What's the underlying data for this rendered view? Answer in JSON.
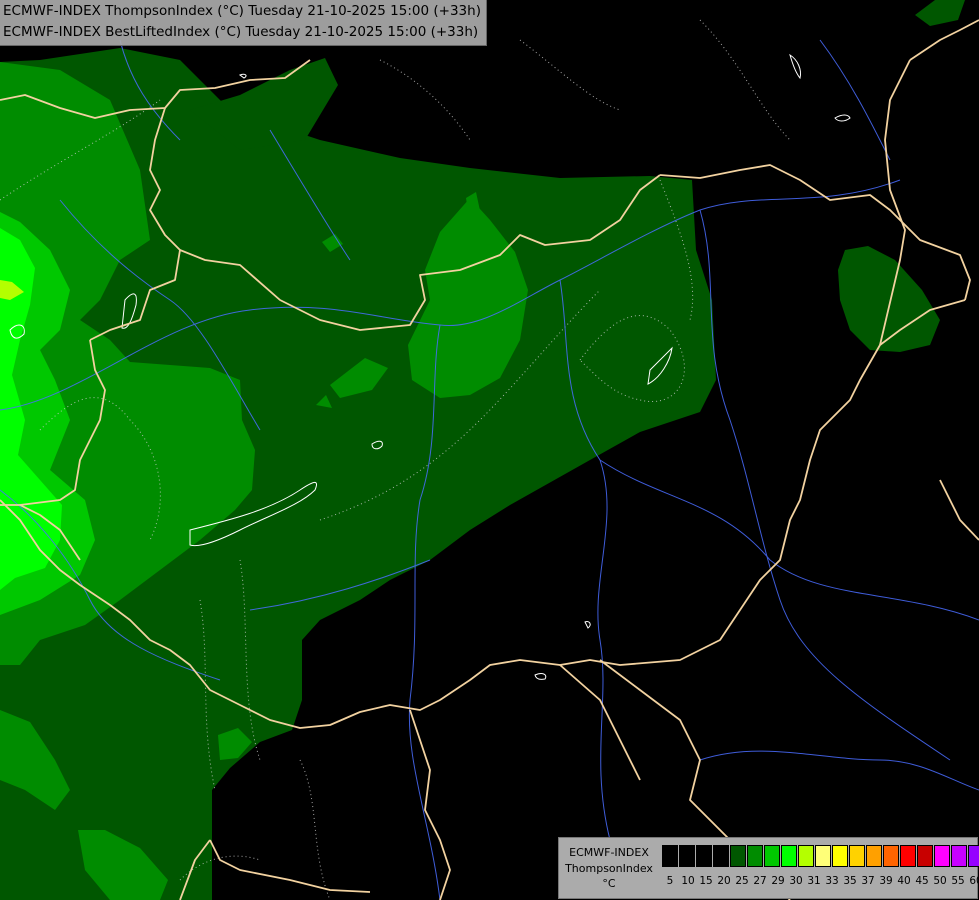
{
  "title": {
    "line1": "ECMWF-INDEX ThompsonIndex (°C) Tuesday 21-10-2025 15:00 (+33h)",
    "line2": "ECMWF-INDEX BestLiftedIndex (°C) Tuesday 21-10-2025 15:00 (+33h)"
  },
  "legend": {
    "model": "ECMWF-INDEX",
    "parameter": "ThompsonIndex",
    "unit": "°C",
    "colors": [
      "#000000",
      "#000000",
      "#000000",
      "#000000",
      "#005700",
      "#008c00",
      "#00c800",
      "#00ff00",
      "#b4ff00",
      "#ffff78",
      "#ffff00",
      "#ffd200",
      "#ffa000",
      "#ff6400",
      "#ff0000",
      "#c80000",
      "#ff00ff",
      "#c800ff",
      "#9600ff",
      "#6400ff",
      "#0000ff"
    ],
    "ticks": [
      "5",
      "10",
      "15",
      "20",
      "25",
      "27",
      "29",
      "30",
      "31",
      "33",
      "35",
      "37",
      "39",
      "40",
      "45",
      "50",
      "55",
      "60"
    ]
  },
  "colors": {
    "level_20": "#005700",
    "level_25": "#008c00",
    "level_27": "#00c800",
    "level_29": "#00ff00",
    "border": "#f2d2a0",
    "river": "#4a6dff"
  }
}
